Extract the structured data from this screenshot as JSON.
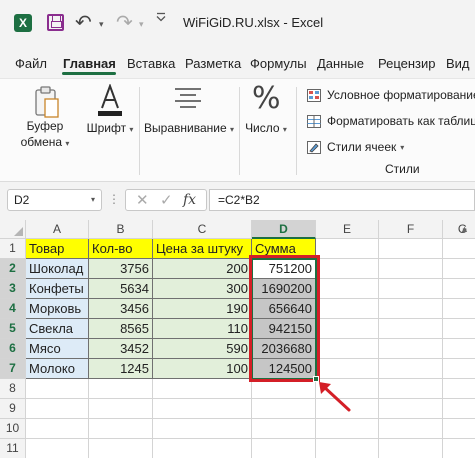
{
  "title_bar": {
    "file_name": "WiFiGiD.RU.xlsx",
    "separator": "-",
    "app_name": "Excel",
    "logo_letter": "X"
  },
  "tabs": [
    {
      "label": "Файл"
    },
    {
      "label": "Главная",
      "active": true
    },
    {
      "label": "Вставка"
    },
    {
      "label": "Разметка"
    },
    {
      "label": "Формулы"
    },
    {
      "label": "Данные"
    },
    {
      "label": "Рецензир"
    },
    {
      "label": "Вид"
    }
  ],
  "ribbon": {
    "clipboard": {
      "line1": "Буфер",
      "line2": "обмена"
    },
    "font": {
      "label": "Шрифт"
    },
    "alignment": {
      "label": "Выравнивание"
    },
    "number": {
      "label": "Число",
      "glyph": "%"
    },
    "styles": {
      "conditional": "Условное форматирование",
      "as_table": "Форматировать как таблицу",
      "cell_styles": "Стили ячеек",
      "group_label": "Стили"
    }
  },
  "formula_bar": {
    "name_box": "D2",
    "fx": "fx",
    "formula": "=C2*B2"
  },
  "sheet": {
    "columns": [
      "A",
      "B",
      "C",
      "D",
      "E",
      "F",
      "G"
    ],
    "rows": [
      "1",
      "2",
      "3",
      "4",
      "5",
      "6",
      "7",
      "8",
      "9",
      "10",
      "11"
    ],
    "headers": [
      "Товар",
      "Кол-во",
      "Цена за штуку",
      "Сумма"
    ],
    "data": [
      [
        "Шоколад",
        "3756",
        "200",
        "751200"
      ],
      [
        "Конфеты",
        "5634",
        "300",
        "1690200"
      ],
      [
        "Морковь",
        "3456",
        "190",
        "656640"
      ],
      [
        "Свекла",
        "8565",
        "110",
        "942150"
      ],
      [
        "Мясо",
        "3452",
        "590",
        "2036680"
      ],
      [
        "Молоко",
        "1245",
        "100",
        "124500"
      ]
    ]
  },
  "colors": {
    "accent": "#1d6f42",
    "header_fill": "#ffff00",
    "text_fill": "#ddebf7",
    "number_fill": "#e2efda",
    "sum_fill": "#c6c6c6",
    "highlight_red": "#d41f27"
  }
}
